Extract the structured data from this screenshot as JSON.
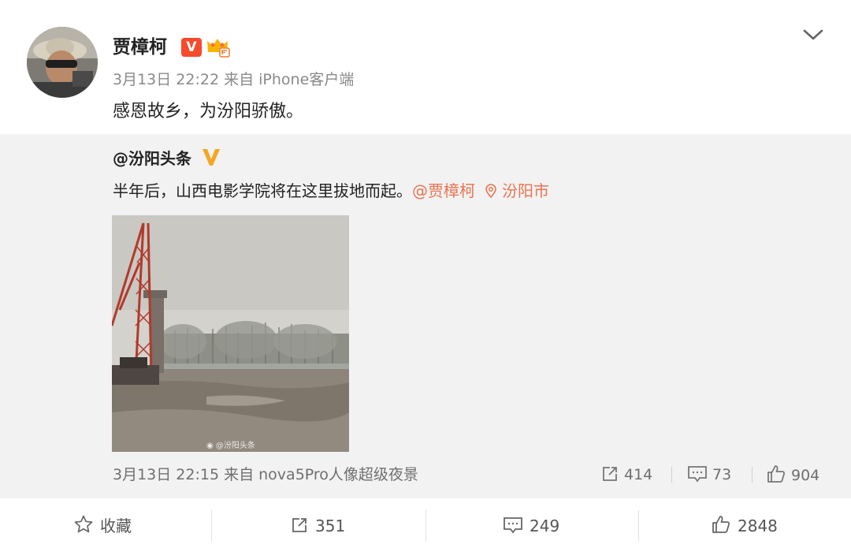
{
  "post": {
    "author": "贾樟柯",
    "verified_badge": "V",
    "meta": "3月13日 22:22 来自 iPhone客户端",
    "text": "感恩故乡，为汾阳骄傲。"
  },
  "repost": {
    "author": "@汾阳头条",
    "text": "半年后，山西电影学院将在这里拔地而起。",
    "mention": "@贾樟柯",
    "location": "汾阳市",
    "image_watermark": "@汾阳头条",
    "meta": "3月13日 22:15 来自 nova5Pro人像超级夜景",
    "stats": {
      "reposts": "414",
      "comments": "73",
      "likes": "904"
    }
  },
  "toolbar": {
    "favorite_label": "收藏",
    "reposts": "351",
    "comments": "249",
    "likes": "2848"
  },
  "colors": {
    "link": "#eb7350",
    "verified_red": "#f64a2d",
    "verified_gold": "#f5a623",
    "repost_bg": "#f2f2f2"
  },
  "icons": [
    "chevron-down-icon",
    "crown-icon",
    "gold-v-icon",
    "location-pin-icon",
    "repost-icon",
    "comment-icon",
    "like-icon",
    "star-icon",
    "weibo-logo-icon"
  ]
}
